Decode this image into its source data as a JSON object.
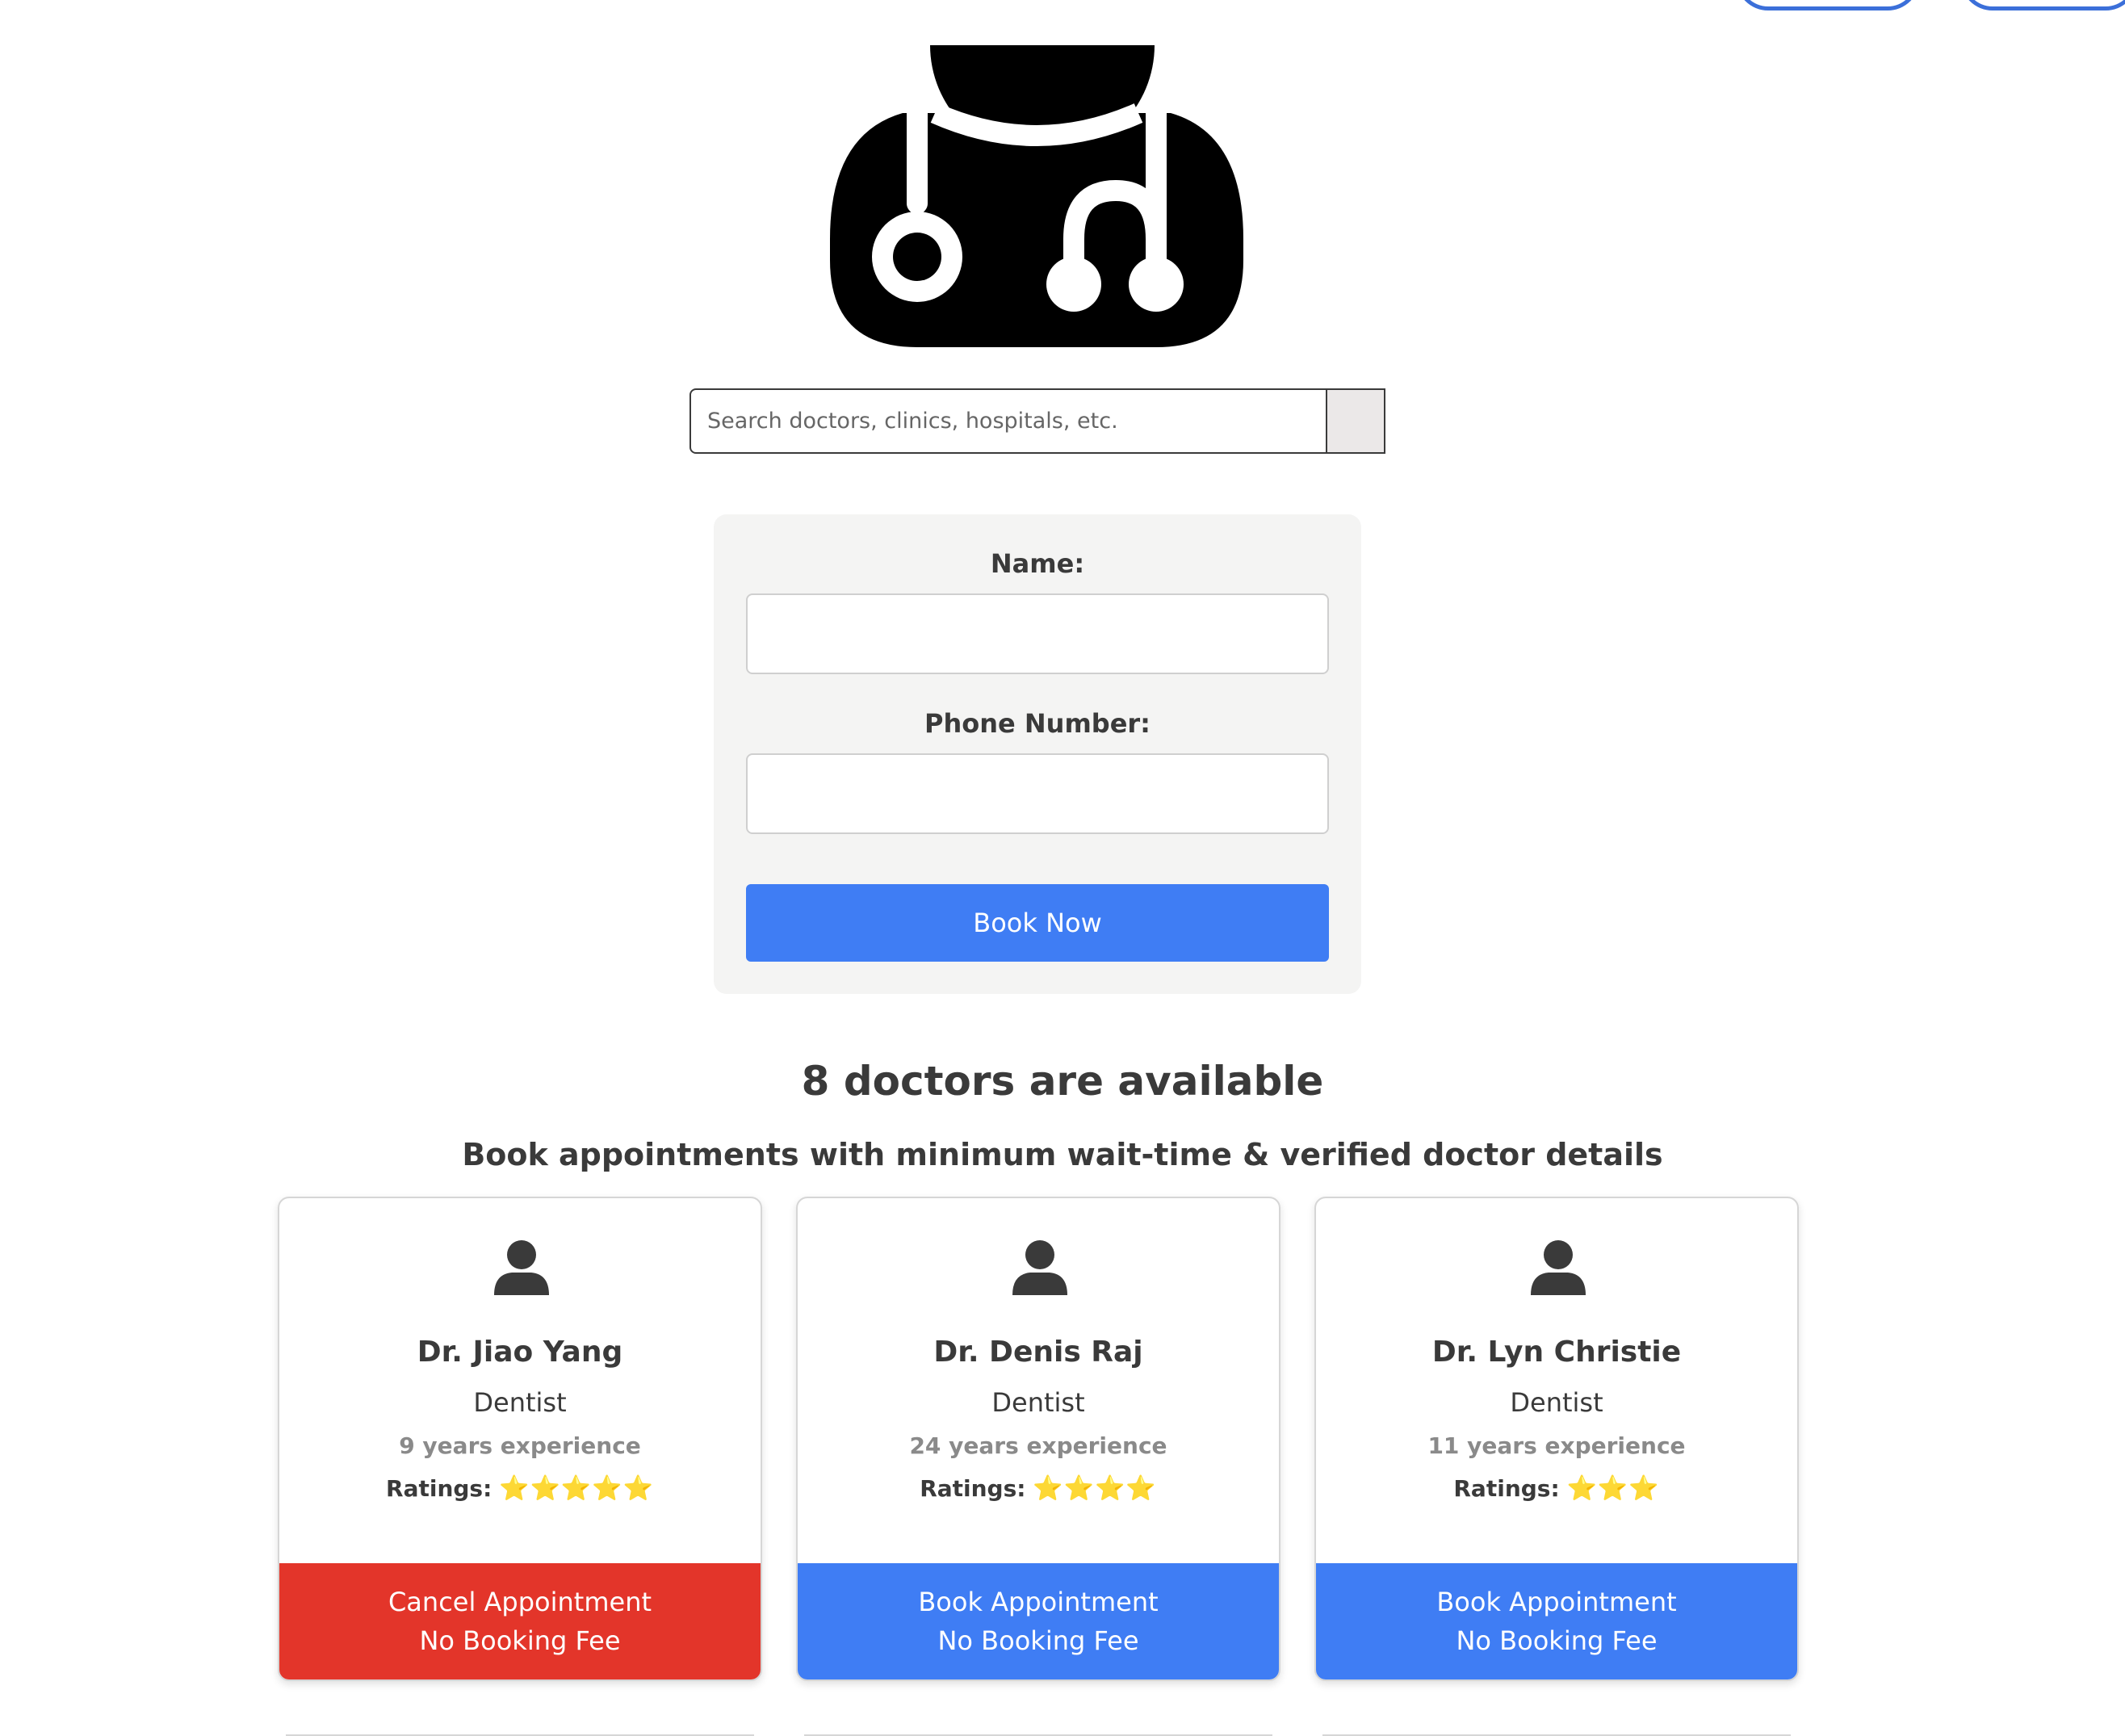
{
  "search": {
    "placeholder": "Search doctors, clinics, hospitals, etc."
  },
  "form": {
    "name_label": "Name:",
    "phone_label": "Phone Number:",
    "book_now_label": "Book Now"
  },
  "listing": {
    "heading": "8 doctors are available",
    "subheading": "Book appointments with minimum wait-time & verified doctor details"
  },
  "doctors": [
    {
      "name": "Dr. Jiao Yang",
      "specialty": "Dentist",
      "experience": "9 years experience",
      "ratings_label": "Ratings:",
      "stars": "⭐⭐⭐⭐⭐",
      "action_label": "Cancel Appointment",
      "fee_label": "No Booking Fee"
    },
    {
      "name": "Dr. Denis Raj",
      "specialty": "Dentist",
      "experience": "24 years experience",
      "ratings_label": "Ratings:",
      "stars": "⭐⭐⭐⭐",
      "action_label": "Book Appointment",
      "fee_label": "No Booking Fee"
    },
    {
      "name": "Dr. Lyn Christie",
      "specialty": "Dentist",
      "experience": "11 years experience",
      "ratings_label": "Ratings:",
      "stars": "⭐⭐⭐",
      "action_label": "Book Appointment",
      "fee_label": "No Booking Fee"
    }
  ],
  "colors": {
    "primary_button": "#3f7df4",
    "cancel_button": "#e3352a",
    "text_dark": "#3a3a3a",
    "text_muted": "#8a8a8a",
    "form_background": "#f4f4f3"
  }
}
